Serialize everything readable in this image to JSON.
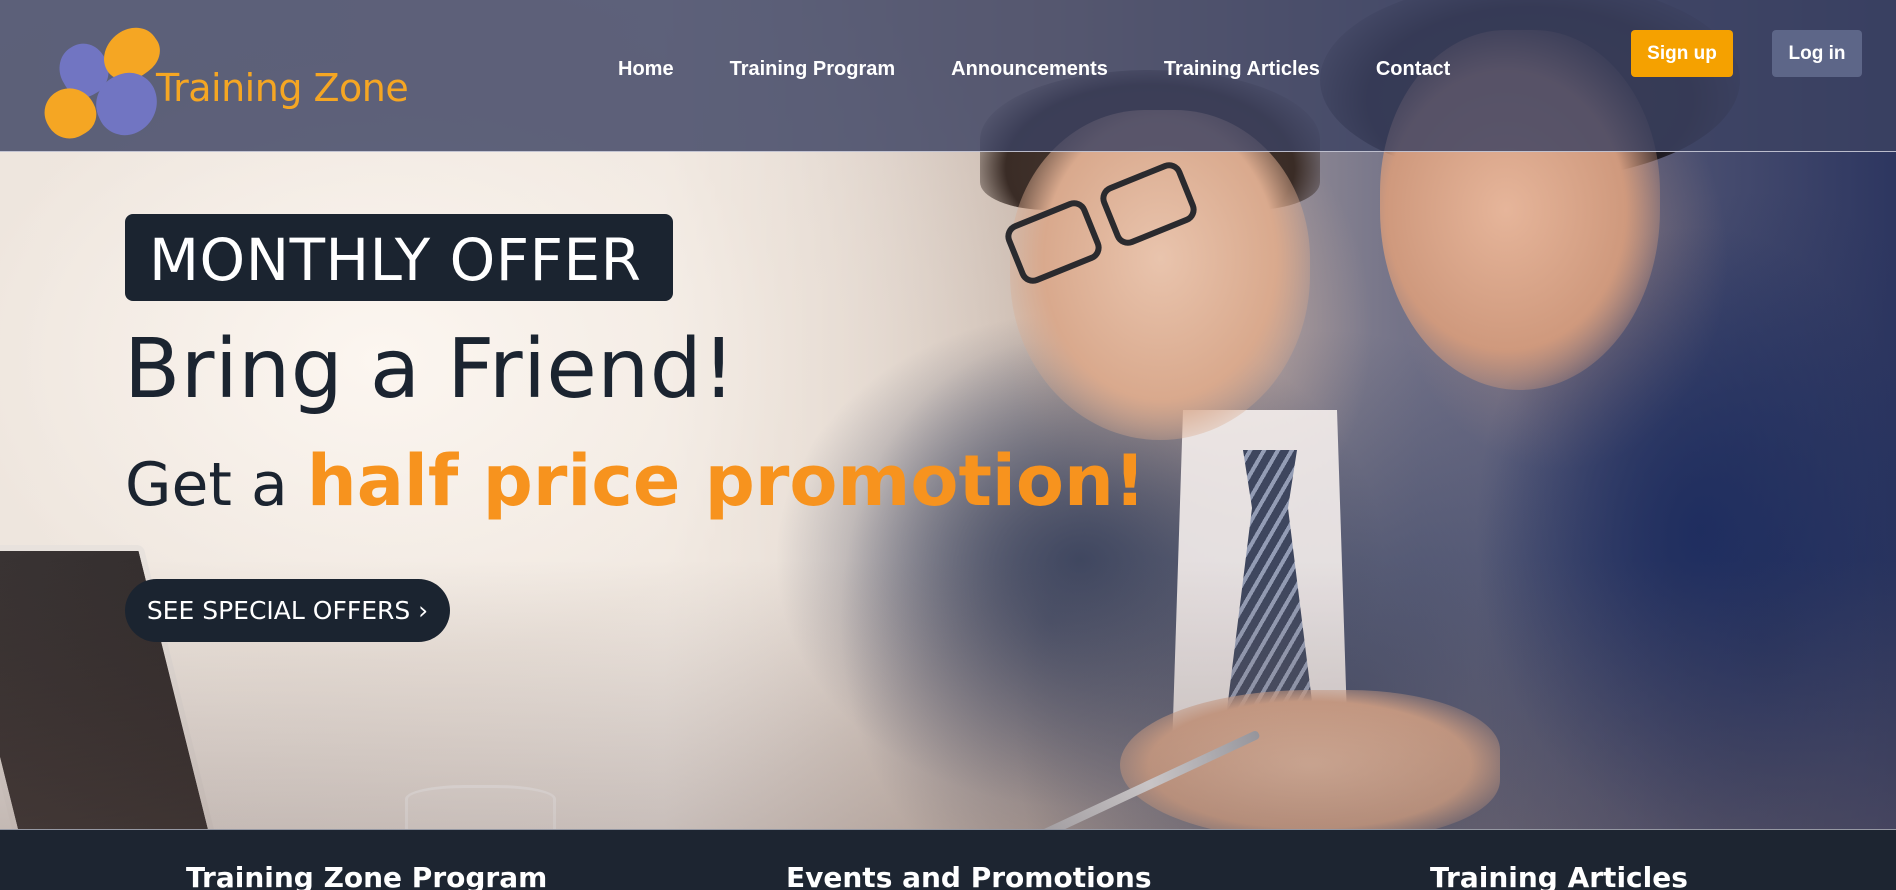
{
  "brand": {
    "name": "Training Zone",
    "colors": {
      "accent_orange": "#f5a623",
      "accent_purple": "#7175c2",
      "navy": "#1b2430",
      "header_bg": "#3c4262",
      "signup_bg": "#f5a100",
      "login_bg": "#5d6688"
    }
  },
  "nav": {
    "items": [
      {
        "label": "Home"
      },
      {
        "label": "Training Program"
      },
      {
        "label": "Announcements"
      },
      {
        "label": "Training Articles"
      },
      {
        "label": "Contact"
      }
    ]
  },
  "auth": {
    "signup_label": "Sign up",
    "login_label": "Log in"
  },
  "hero": {
    "badge": "MONTHLY OFFER",
    "headline": "Bring a Friend!",
    "subline_prefix": "Get a ",
    "subline_accent": "half price promotion!",
    "cta_label": "SEE SPECIAL OFFERS ›"
  },
  "footer": {
    "columns": [
      {
        "title": "Training Zone Program"
      },
      {
        "title": "Events and Promotions"
      },
      {
        "title": "Training Articles"
      }
    ]
  }
}
